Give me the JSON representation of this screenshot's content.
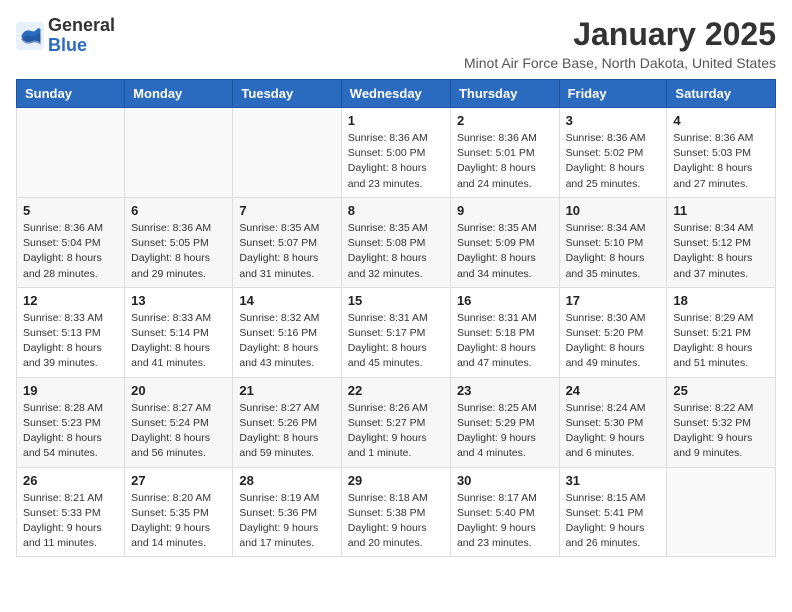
{
  "header": {
    "logo_general": "General",
    "logo_blue": "Blue",
    "month_title": "January 2025",
    "subtitle": "Minot Air Force Base, North Dakota, United States"
  },
  "days_of_week": [
    "Sunday",
    "Monday",
    "Tuesday",
    "Wednesday",
    "Thursday",
    "Friday",
    "Saturday"
  ],
  "weeks": [
    [
      {
        "day": "",
        "info": ""
      },
      {
        "day": "",
        "info": ""
      },
      {
        "day": "",
        "info": ""
      },
      {
        "day": "1",
        "info": "Sunrise: 8:36 AM\nSunset: 5:00 PM\nDaylight: 8 hours\nand 23 minutes."
      },
      {
        "day": "2",
        "info": "Sunrise: 8:36 AM\nSunset: 5:01 PM\nDaylight: 8 hours\nand 24 minutes."
      },
      {
        "day": "3",
        "info": "Sunrise: 8:36 AM\nSunset: 5:02 PM\nDaylight: 8 hours\nand 25 minutes."
      },
      {
        "day": "4",
        "info": "Sunrise: 8:36 AM\nSunset: 5:03 PM\nDaylight: 8 hours\nand 27 minutes."
      }
    ],
    [
      {
        "day": "5",
        "info": "Sunrise: 8:36 AM\nSunset: 5:04 PM\nDaylight: 8 hours\nand 28 minutes."
      },
      {
        "day": "6",
        "info": "Sunrise: 8:36 AM\nSunset: 5:05 PM\nDaylight: 8 hours\nand 29 minutes."
      },
      {
        "day": "7",
        "info": "Sunrise: 8:35 AM\nSunset: 5:07 PM\nDaylight: 8 hours\nand 31 minutes."
      },
      {
        "day": "8",
        "info": "Sunrise: 8:35 AM\nSunset: 5:08 PM\nDaylight: 8 hours\nand 32 minutes."
      },
      {
        "day": "9",
        "info": "Sunrise: 8:35 AM\nSunset: 5:09 PM\nDaylight: 8 hours\nand 34 minutes."
      },
      {
        "day": "10",
        "info": "Sunrise: 8:34 AM\nSunset: 5:10 PM\nDaylight: 8 hours\nand 35 minutes."
      },
      {
        "day": "11",
        "info": "Sunrise: 8:34 AM\nSunset: 5:12 PM\nDaylight: 8 hours\nand 37 minutes."
      }
    ],
    [
      {
        "day": "12",
        "info": "Sunrise: 8:33 AM\nSunset: 5:13 PM\nDaylight: 8 hours\nand 39 minutes."
      },
      {
        "day": "13",
        "info": "Sunrise: 8:33 AM\nSunset: 5:14 PM\nDaylight: 8 hours\nand 41 minutes."
      },
      {
        "day": "14",
        "info": "Sunrise: 8:32 AM\nSunset: 5:16 PM\nDaylight: 8 hours\nand 43 minutes."
      },
      {
        "day": "15",
        "info": "Sunrise: 8:31 AM\nSunset: 5:17 PM\nDaylight: 8 hours\nand 45 minutes."
      },
      {
        "day": "16",
        "info": "Sunrise: 8:31 AM\nSunset: 5:18 PM\nDaylight: 8 hours\nand 47 minutes."
      },
      {
        "day": "17",
        "info": "Sunrise: 8:30 AM\nSunset: 5:20 PM\nDaylight: 8 hours\nand 49 minutes."
      },
      {
        "day": "18",
        "info": "Sunrise: 8:29 AM\nSunset: 5:21 PM\nDaylight: 8 hours\nand 51 minutes."
      }
    ],
    [
      {
        "day": "19",
        "info": "Sunrise: 8:28 AM\nSunset: 5:23 PM\nDaylight: 8 hours\nand 54 minutes."
      },
      {
        "day": "20",
        "info": "Sunrise: 8:27 AM\nSunset: 5:24 PM\nDaylight: 8 hours\nand 56 minutes."
      },
      {
        "day": "21",
        "info": "Sunrise: 8:27 AM\nSunset: 5:26 PM\nDaylight: 8 hours\nand 59 minutes."
      },
      {
        "day": "22",
        "info": "Sunrise: 8:26 AM\nSunset: 5:27 PM\nDaylight: 9 hours\nand 1 minute."
      },
      {
        "day": "23",
        "info": "Sunrise: 8:25 AM\nSunset: 5:29 PM\nDaylight: 9 hours\nand 4 minutes."
      },
      {
        "day": "24",
        "info": "Sunrise: 8:24 AM\nSunset: 5:30 PM\nDaylight: 9 hours\nand 6 minutes."
      },
      {
        "day": "25",
        "info": "Sunrise: 8:22 AM\nSunset: 5:32 PM\nDaylight: 9 hours\nand 9 minutes."
      }
    ],
    [
      {
        "day": "26",
        "info": "Sunrise: 8:21 AM\nSunset: 5:33 PM\nDaylight: 9 hours\nand 11 minutes."
      },
      {
        "day": "27",
        "info": "Sunrise: 8:20 AM\nSunset: 5:35 PM\nDaylight: 9 hours\nand 14 minutes."
      },
      {
        "day": "28",
        "info": "Sunrise: 8:19 AM\nSunset: 5:36 PM\nDaylight: 9 hours\nand 17 minutes."
      },
      {
        "day": "29",
        "info": "Sunrise: 8:18 AM\nSunset: 5:38 PM\nDaylight: 9 hours\nand 20 minutes."
      },
      {
        "day": "30",
        "info": "Sunrise: 8:17 AM\nSunset: 5:40 PM\nDaylight: 9 hours\nand 23 minutes."
      },
      {
        "day": "31",
        "info": "Sunrise: 8:15 AM\nSunset: 5:41 PM\nDaylight: 9 hours\nand 26 minutes."
      },
      {
        "day": "",
        "info": ""
      }
    ]
  ]
}
